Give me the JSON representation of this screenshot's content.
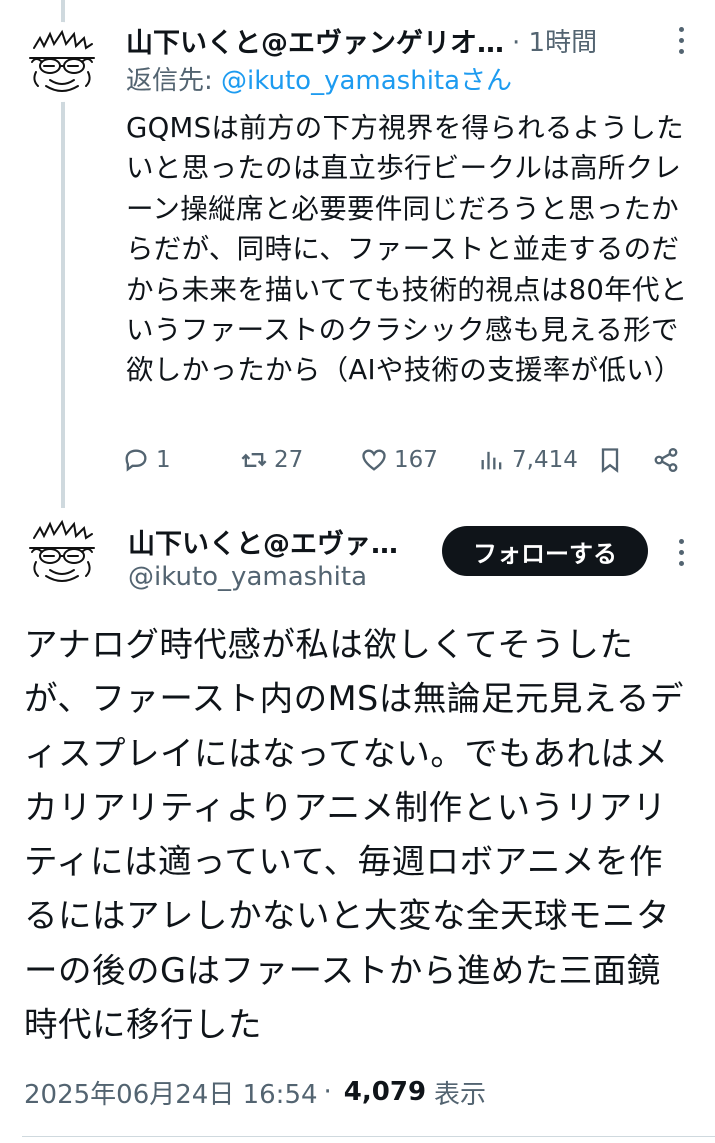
{
  "reply": {
    "author_name": "山下いくと@エヴァンゲリオ…",
    "time": "· 1時間",
    "reply_to_prefix": "返信先: ",
    "reply_to_handle": "@ikuto_yamashitaさん",
    "text": "GQMSは前方の下方視界を得られるようしたいと思ったのは直立歩行ビークルは高所クレーン操縦席と必要要件同じだろうと思ったからだが、同時に、ファーストと並走するのだから未来を描いてても技術的視点は80年代というファーストのクラシック感も見える形で欲しかったから（AIや技術の支援率が低い）",
    "actions": {
      "replies": "1",
      "reposts": "27",
      "likes": "167",
      "views": "7,414"
    }
  },
  "main": {
    "author_name": "山下いくと@エヴァ…",
    "handle": "@ikuto_yamashita",
    "follow_label": "フォローする",
    "text": "アナログ時代感が私は欲しくてそうしたが、ファースト内のMSは無論足元見えるディスプレイにはなってない。でもあれはメカリアリティよりアニメ制作というリアリティには適っていて、毎週ロボアニメを作るにはアレしかないと大変な全天球モニターの後のGはファーストから進めた三面鏡時代に移行した",
    "timestamp": "2025年06月24日 16:54",
    "separator": "·",
    "views_count": "4,079",
    "views_label": "表示"
  },
  "colors": {
    "text_primary": "#0f1419",
    "text_secondary": "#536471",
    "link": "#1d9bf0",
    "follow_bg": "#0f1419",
    "thread_line": "#cfd9de"
  },
  "icons": {
    "reply": "reply-icon",
    "repost": "repost-icon",
    "like": "heart-icon",
    "views": "views-icon",
    "bookmark": "bookmark-icon",
    "share": "share-icon",
    "more": "more-icon"
  }
}
